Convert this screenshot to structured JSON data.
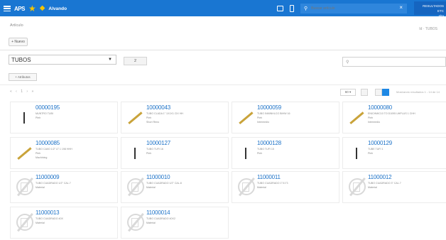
{
  "topbar": {
    "app_logo": "APS",
    "brand_name": "Alvando",
    "search_placeholder": "Buscar artículo",
    "user_lines": [
      "RESULTADOS ETC",
      "Alta"
    ]
  },
  "header": {
    "crumb": "Artículo",
    "crumb_right": "Id · TUBOS",
    "new_button": "+ Nuevo"
  },
  "toolbar": {
    "category_value": "TUBOS",
    "count_button": "2",
    "filter_button": "+ Atributos",
    "pager": "«  ‹  1  ›  »",
    "per_page": "60 ▾",
    "records_text": "Mostrando resultados 1 - 14 de 14"
  },
  "icons": {
    "menu": "hamburger-icon",
    "star": "star-icon",
    "chat": "chat-icon",
    "phone": "phone-icon",
    "search": "search-icon",
    "clear": "close-icon"
  },
  "colors": {
    "topbar": "#1976d2",
    "accent": "#1e88e5",
    "code_text": "#1e73c8",
    "star": "#f5c400"
  },
  "cards": [
    {
      "code": "00000195",
      "desc": "MUNTRO TUBI",
      "l2": "Pieh",
      "l3": "",
      "thumb": "bar-dark"
    },
    {
      "code": "10000043",
      "desc": "TUBO CLADA 1\" 1X1X1 CIX HH",
      "l2": "Pieh",
      "l3": "Short Reno",
      "thumb": "bar-gold"
    },
    {
      "code": "10000059",
      "desc": "TUBO INMINHLCO BIHW 16",
      "l2": "Pieh",
      "l3": "Intermedio",
      "thumb": "bar-gold"
    },
    {
      "code": "10000080",
      "desc": "ENICHMIC10 TO D1095 UHPLUS 1 CHH",
      "l2": "Pieh",
      "l3": "Intermedio",
      "thumb": "bar-gold"
    },
    {
      "code": "10000085",
      "desc": "TUBO CAIIO 1/2\" LT 1 198 HHH",
      "l2": "Pieh",
      "l3": "Machining",
      "thumb": "bar-gold"
    },
    {
      "code": "10000127",
      "desc": "TUBO TUFI 16",
      "l2": "Pieh",
      "l3": "",
      "thumb": "bar-dark"
    },
    {
      "code": "10000128",
      "desc": "TUBO TUFI 15",
      "l2": "Pieh",
      "l3": "",
      "thumb": "bar-dark"
    },
    {
      "code": "10000129",
      "desc": "TUBE TUFI 1",
      "l2": "Pieh",
      "l3": "",
      "thumb": "bar-dark"
    },
    {
      "code": "11000009",
      "desc": "TUBO CUADRADO 1/2\" CAL.7",
      "l2": "Material",
      "l3": "",
      "thumb": "placeholder"
    },
    {
      "code": "11000010",
      "desc": "TUBO CUADRADO 1/2\" CAL.8",
      "l2": "Material",
      "l3": "",
      "thumb": "placeholder"
    },
    {
      "code": "11000011",
      "desc": "TUBO CUADRADO 1\"X1\"3",
      "l2": "Material",
      "l3": "",
      "thumb": "placeholder"
    },
    {
      "code": "11000012",
      "desc": "TUBO CUADRADO 3\" CAL.7",
      "l2": "Material",
      "l3": "",
      "thumb": "placeholder"
    },
    {
      "code": "11000013",
      "desc": "TUBO CUADRADO 40X",
      "l2": "Material",
      "l3": "",
      "thumb": "placeholder"
    },
    {
      "code": "11000014",
      "desc": "TUBO CUADRADO 40X2",
      "l2": "Material",
      "l3": "",
      "thumb": "placeholder"
    }
  ]
}
